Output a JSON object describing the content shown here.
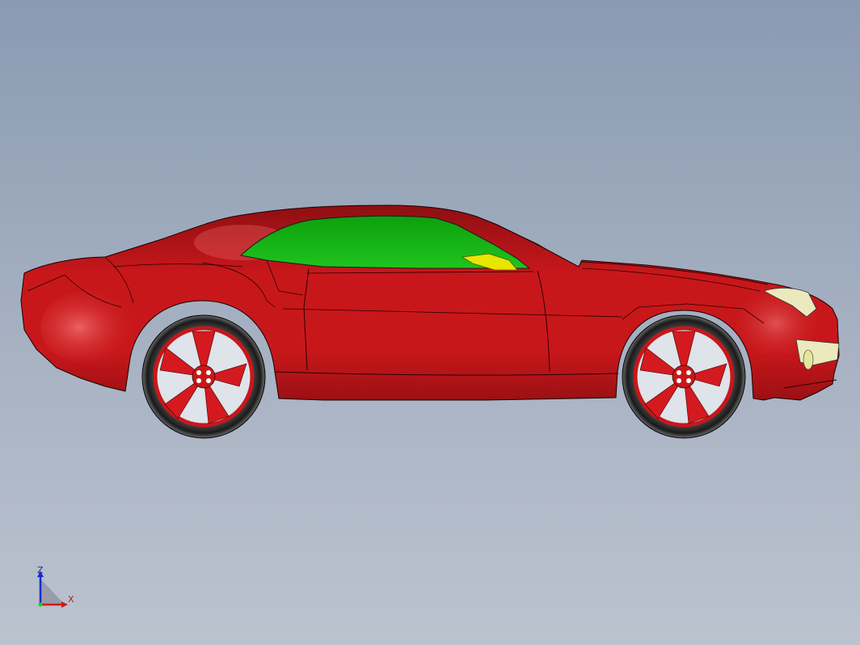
{
  "viewport": {
    "background_top": "#8a9ab1",
    "background_bottom": "#bcc3cf"
  },
  "model": {
    "body_color": "#c8171b",
    "glass_color": "#19b318",
    "accent_color": "#e6e600",
    "headlight_color": "#ece9bf"
  },
  "triad": {
    "z_label": "Z",
    "x_label": "X"
  }
}
